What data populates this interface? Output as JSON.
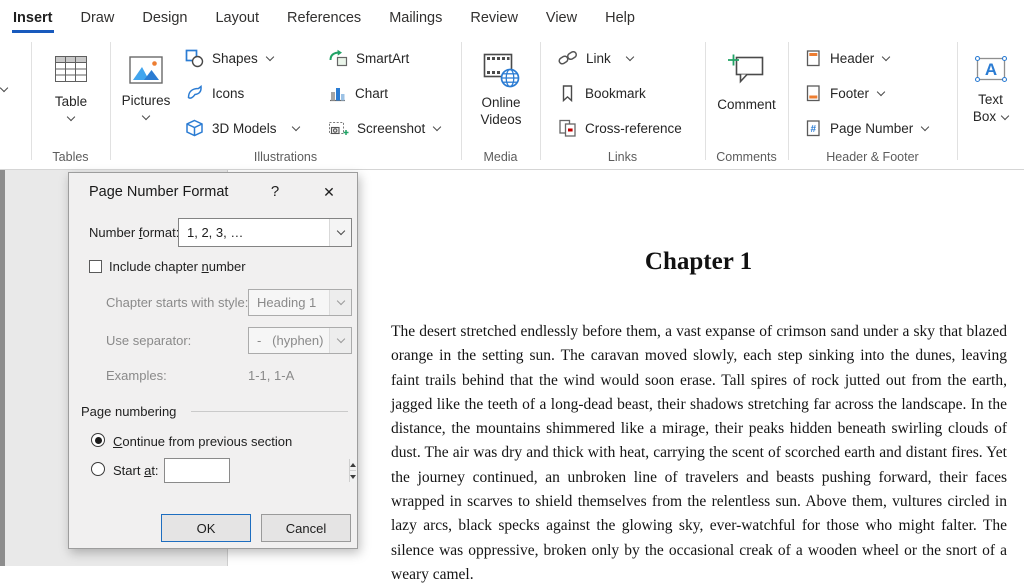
{
  "menu": {
    "tabs": [
      "Insert",
      "Draw",
      "Design",
      "Layout",
      "References",
      "Mailings",
      "Review",
      "View",
      "Help"
    ],
    "active_tab": "Insert"
  },
  "ribbon": {
    "table": "Table",
    "pictures": "Pictures",
    "shapes": "Shapes",
    "icons": "Icons",
    "models3d": "3D Models",
    "smartart": "SmartArt",
    "chart": "Chart",
    "screenshot": "Screenshot",
    "online_videos_line1": "Online",
    "online_videos_line2": "Videos",
    "link": "Link",
    "bookmark": "Bookmark",
    "crossref": "Cross-reference",
    "comment": "Comment",
    "header": "Header",
    "footer": "Footer",
    "page_number": "Page Number",
    "textbox_line1": "Text",
    "textbox_line2": "Box",
    "group_labels": {
      "tables": "Tables",
      "illustrations": "Illustrations",
      "media": "Media",
      "links": "Links",
      "comments": "Comments",
      "header_footer": "Header & Footer"
    }
  },
  "dialog": {
    "title": "Page Number Format",
    "help_glyph": "?",
    "close_glyph": "✕",
    "number_format": {
      "pre": "Number ",
      "mn": "f",
      "post": "ormat:"
    },
    "number_format_value": "1, 2, 3, …",
    "include_chapter": {
      "pre": "Include chapter ",
      "mn": "n",
      "post": "umber"
    },
    "chapter_style_label": "Chapter starts with style:",
    "chapter_style_value": "Heading 1",
    "separator_label": "Use separator:",
    "separator_value": "-   (hyphen)",
    "examples_label": "Examples:",
    "examples_value": "1-1, 1-A",
    "section_label": "Page numbering",
    "continue_option": {
      "pre": "",
      "mn": "C",
      "post": "ontinue from previous section"
    },
    "start_option": {
      "pre": "Start ",
      "mn": "a",
      "post": "t:"
    },
    "start_value": "",
    "ok_label": "OK",
    "cancel_label": "Cancel"
  },
  "document": {
    "heading": "Chapter 1",
    "paragraph": "The desert stretched endlessly before them, a vast expanse of crimson sand under a sky that blazed orange in the setting sun. The caravan moved slowly, each step sinking into the dunes, leaving faint trails behind that the wind would soon erase. Tall spires of rock jutted out from the earth, jagged like the teeth of a long-dead beast, their shadows stretching far across the landscape. In the distance, the mountains shimmered like a mirage, their peaks hidden beneath swirling clouds of dust. The air was dry and thick with heat, carrying the scent of scorched earth and distant fires. Yet the journey continued, an unbroken line of travelers and beasts pushing forward, their faces wrapped in scarves to shield themselves from the relentless sun. Above them, vultures circled in lazy arcs, black specks against the glowing sky, ever-watchful for those who might falter. The silence was oppressive, broken only by the occasional creak of a wooden wheel or the snort of a weary camel."
  },
  "colors": {
    "accent_underline": "#185abd",
    "icon_blue": "#2b7cd3",
    "icon_orange": "#ed7d31",
    "icon_green": "#21a366",
    "ok_border": "#1e6ec0"
  }
}
